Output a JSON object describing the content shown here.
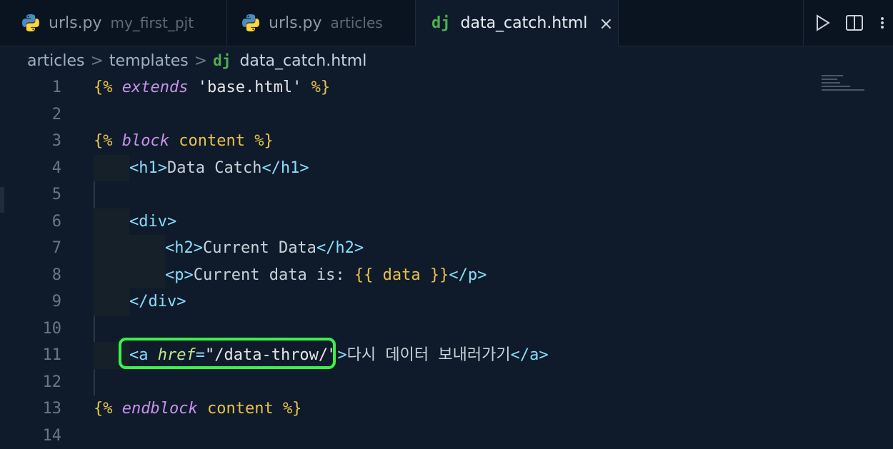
{
  "tabs": [
    {
      "icon": "python-icon",
      "name": "urls.py",
      "desc": "my_first_pjt"
    },
    {
      "icon": "python-icon",
      "name": "urls.py",
      "desc": "articles"
    },
    {
      "icon": "django-icon",
      "icon_text": "dj",
      "name": "data_catch.html",
      "close": "×"
    }
  ],
  "breadcrumb": {
    "folder1": "articles",
    "folder2": "templates",
    "icon_text": "dj",
    "file": "data_catch.html",
    "sep": ">"
  },
  "lines": {
    "n1": "1",
    "n2": "2",
    "n3": "3",
    "n4": "4",
    "n5": "5",
    "n6": "6",
    "n7": "7",
    "n8": "8",
    "n9": "9",
    "n10": "10",
    "n11": "11",
    "n12": "12",
    "n13": "13",
    "n14": "14"
  },
  "code": {
    "l1": {
      "open": "{%",
      "kw": "extends",
      "str": "'base.html'",
      "close": "%}"
    },
    "l3": {
      "open": "{%",
      "kw": "block",
      "name": "content",
      "close": "%}"
    },
    "l4": {
      "open_tag": "<h1>",
      "text": "Data Catch",
      "close_tag": "</h1>"
    },
    "l6": {
      "tag": "<div>"
    },
    "l7": {
      "open_tag": "<h2>",
      "text": "Current Data",
      "close_tag": "</h2>"
    },
    "l8": {
      "open_tag": "<p>",
      "text": "Current data is: ",
      "var": "{{ data }}",
      "close_tag": "</p>"
    },
    "l9": {
      "tag": "</div>"
    },
    "l11": {
      "open": "<a",
      "attr": "href",
      "eq": "=",
      "str": "\"/data-throw/\"",
      "gt": ">",
      "text": "다시 데이터 보내러가기",
      "close_tag": "</a>"
    },
    "l13": {
      "open": "{%",
      "kw": "endblock",
      "name": "content",
      "close": "%}"
    }
  },
  "colors": {
    "highlight_border": "#3cf04a",
    "django": "#4caf50"
  }
}
